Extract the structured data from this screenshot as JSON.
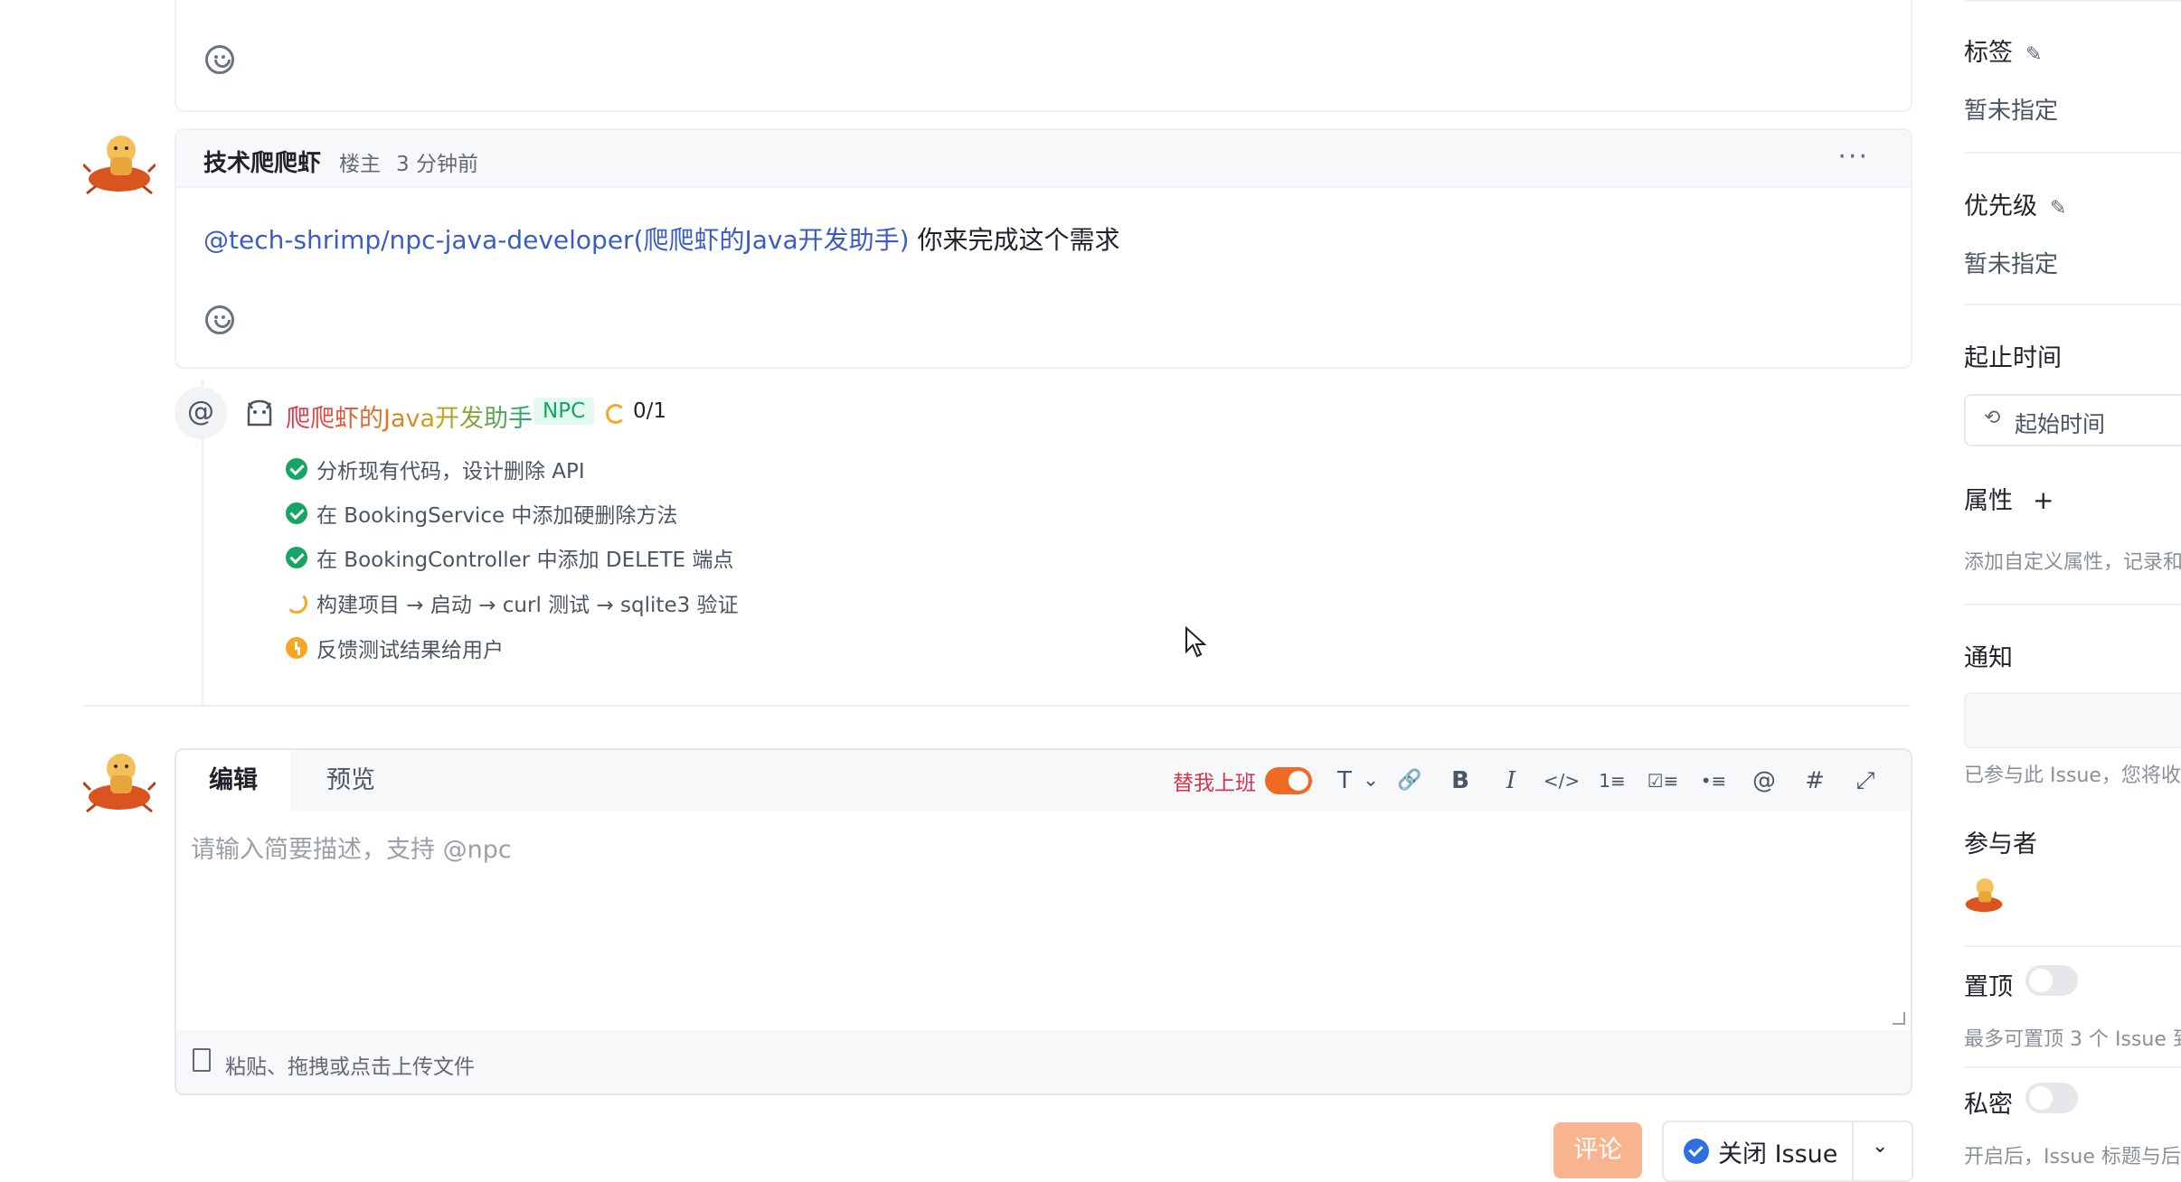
{
  "comment": {
    "author": "技术爬爬虾",
    "role": "楼主",
    "time": "3 分钟前",
    "more": "···",
    "mention": "@tech-shrimp/npc-java-developer(爬爬虾的Java开发助手)",
    "text": " 你来完成这个需求"
  },
  "npc": {
    "at_symbol": "@",
    "name": "爬爬虾的Java开发助手",
    "badge": "NPC",
    "progress": "0/1",
    "tasks": [
      {
        "status": "done",
        "text": "分析现有代码，设计删除 API"
      },
      {
        "status": "done",
        "text": "在 BookingService 中添加硬删除方法"
      },
      {
        "status": "done",
        "text": "在 BookingController 中添加 DELETE 端点"
      },
      {
        "status": "in-progress",
        "text": "构建项目 → 启动 → curl 测试 → sqlite3 验证"
      },
      {
        "status": "pending",
        "text": "反馈测试结果给用户"
      }
    ]
  },
  "editor": {
    "tab_edit": "编辑",
    "tab_preview": "预览",
    "auto_label": "替我上班",
    "auto_on": true,
    "placeholder": "请输入简要描述，支持 @npc",
    "upload_hint": "粘贴、拖拽或点击上传文件",
    "toolbar": {
      "text": "T",
      "chevron": "⌄",
      "link": "🔗",
      "bold": "B",
      "italic": "I",
      "code": "</>",
      "ordered": "1≡",
      "checklist": "☑≡",
      "bullet": "•≡",
      "mention": "@",
      "hash": "#",
      "fullscreen": "⤢"
    }
  },
  "actions": {
    "comment": "评论",
    "close_issue": "关闭 Issue",
    "chevron": "⌄"
  },
  "sidebar": {
    "tags_label": "标签",
    "tags_value": "暂未指定",
    "priority_label": "优先级",
    "priority_value": "暂未指定",
    "dates_label": "起止时间",
    "start_placeholder": "起始时间",
    "attrs_label": "属性",
    "attrs_add": "+",
    "attrs_hint": "添加自定义属性，记录和",
    "notify_label": "通知",
    "notify_hint": "已参与此 Issue，您将收",
    "participants_label": "参与者",
    "pin_label": "置顶",
    "pin_on": false,
    "pin_hint": "最多可置顶 3 个 Issue 到",
    "private_label": "私密",
    "private_on": false,
    "private_hint": "开启后，Issue 标题与后"
  },
  "colors": {
    "accent": "#f06a23",
    "success": "#17a565",
    "warning": "#f5a623",
    "link": "#3b5cc4",
    "primary_button": "#2f6fdf"
  }
}
